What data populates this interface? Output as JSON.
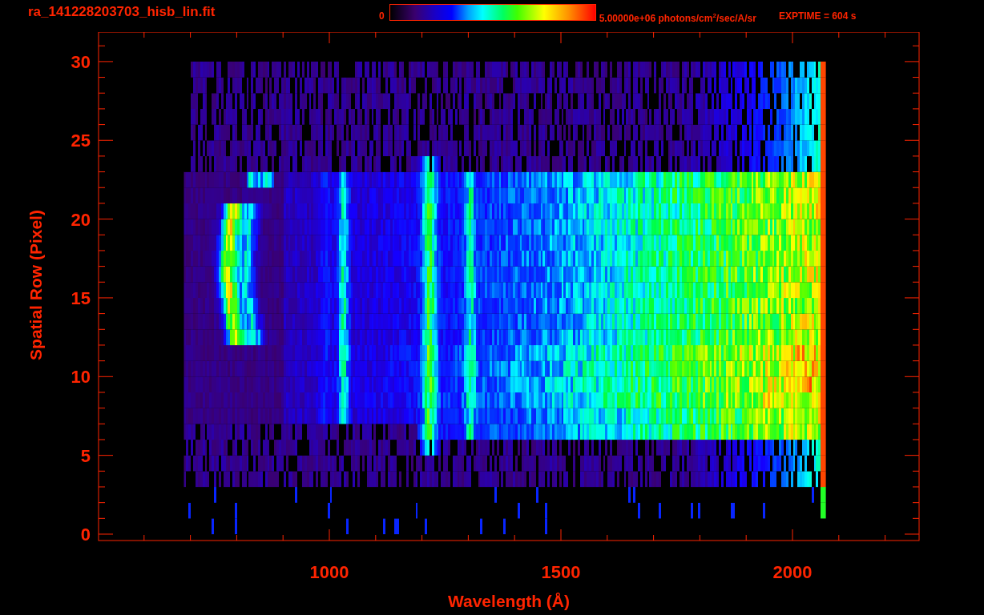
{
  "header": {
    "title": "ra_141228203703_hisb_lin.fit",
    "colorbar": {
      "min_label": "0",
      "max_label": "5.00000e+06 photons/cm$^{2}$/sec/A/sr"
    },
    "exposure": "EXPTIME = 604 s"
  },
  "plot": {
    "x_axis": {
      "label": "Wavelength (Å)",
      "ticks": [
        "1000",
        "1500",
        "2000"
      ]
    },
    "y_axis": {
      "label": "Spatial Row (Pixel)",
      "ticks": [
        "30",
        "25",
        "20",
        "15",
        "10",
        "5",
        "0"
      ]
    }
  }
}
